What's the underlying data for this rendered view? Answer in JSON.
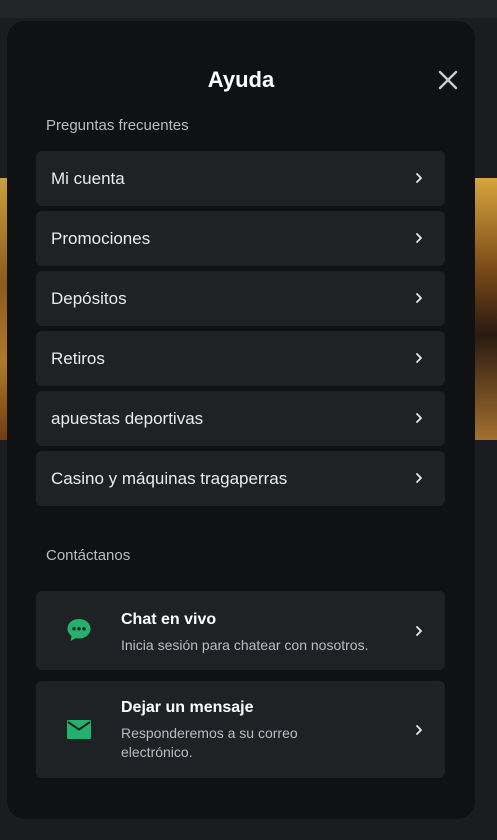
{
  "modal": {
    "title": "Ayuda"
  },
  "faq": {
    "section_label": "Preguntas frecuentes",
    "items": [
      {
        "label": "Mi cuenta"
      },
      {
        "label": "Promociones"
      },
      {
        "label": "Depósitos"
      },
      {
        "label": "Retiros"
      },
      {
        "label": "apuestas deportivas"
      },
      {
        "label": "Casino y máquinas tragaperras"
      }
    ]
  },
  "contact": {
    "section_label": "Contáctanos",
    "chat": {
      "title": "Chat en vivo",
      "subtitle": "Inicia sesión para chatear con nosotros."
    },
    "message": {
      "title": "Dejar un mensaje",
      "subtitle": "Responderemos a su correo electrónico."
    }
  },
  "colors": {
    "accent": "#23b26d",
    "modal_bg": "#0f1113",
    "item_bg": "#1f2225"
  },
  "icons": {
    "close": "close-icon",
    "chevron": "chevron-right-icon",
    "chat": "chat-bubble-icon",
    "message": "mail-icon"
  }
}
